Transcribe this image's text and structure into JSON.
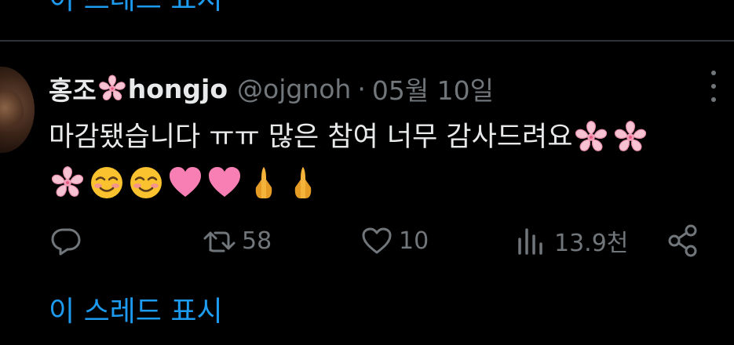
{
  "colors": {
    "background": "#000000",
    "text_primary": "#e7e9ea",
    "text_secondary": "#71767b",
    "link": "#1d9bf0",
    "divider": "#2f3336"
  },
  "top_thread_link": "이 스레드 표시",
  "tweet": {
    "author": {
      "name_prefix": "홍조",
      "name_suffix": "hongjo",
      "name_emoji": "cherry-blossom",
      "handle": "@ojgnoh",
      "separator": "·",
      "date": "05월 10일"
    },
    "text_line1": "마감됐습니다 ㅠㅠ 많은 참여 너무 감사드려요",
    "text_line1_emojis": [
      "cherry-blossom",
      "cherry-blossom"
    ],
    "text_line2_emojis": [
      "cherry-blossom",
      "smiling-face",
      "smiling-face",
      "pink-heart",
      "pink-heart",
      "folded-hands",
      "folded-hands"
    ],
    "actions": {
      "reply": {
        "icon": "reply-icon",
        "count": ""
      },
      "retweet": {
        "icon": "retweet-icon",
        "count": "58"
      },
      "like": {
        "icon": "heart-icon",
        "count": "10"
      },
      "views": {
        "icon": "views-icon",
        "count": "13.9천"
      },
      "share": {
        "icon": "share-icon"
      }
    }
  },
  "thread_link": "이 스레드 표시"
}
